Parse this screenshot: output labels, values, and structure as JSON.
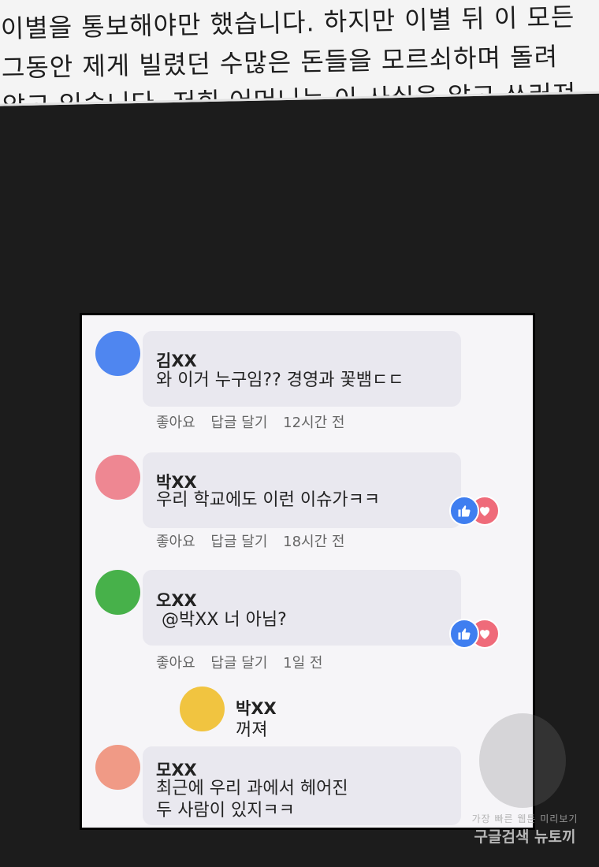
{
  "banner": {
    "line1": "이별을 통보해야만 했습니다. 하지만 이별 뒤 이 모든",
    "line2": "그동안 제게 빌렸던 수많은 돈들을 모르쇠하며 돌려",
    "line3": "않고 있습니다. 저희 어머니는 이 사실을 알고 쓰러져"
  },
  "colors": {
    "like": "#3f7ef0",
    "heart": "#ef6b7a",
    "avatar_blue": "#4f86f0",
    "avatar_pink": "#ee8792",
    "avatar_green": "#47b14a",
    "avatar_yellow": "#f1c440",
    "avatar_salmon": "#f09a86"
  },
  "comments": [
    {
      "name": "김XX",
      "text": "와 이거 누구임?? 경영과 꽃뱀ㄷㄷ",
      "like": "좋아요",
      "reply": "답글 달기",
      "time": "12시간 전"
    },
    {
      "name": "박XX",
      "text": "우리 학교에도 이런 이슈가ㅋㅋ",
      "like": "좋아요",
      "reply": "답글 달기",
      "time": "18시간 전",
      "reactions": [
        "like-icon",
        "heart-icon"
      ]
    },
    {
      "name": "오XX",
      "text": "@박XX 너 아님?",
      "like": "좋아요",
      "reply": "답글 달기",
      "time": "1일 전",
      "reactions": [
        "like-icon",
        "heart-icon"
      ]
    },
    {
      "name": "모XX",
      "text_line1": "최근에 우리 과에서 헤어진",
      "text_line2": "두 사람이 있지ㅋㅋ"
    }
  ],
  "reply": {
    "name": "박XX",
    "text": "꺼져"
  },
  "watermark": {
    "line1": "가장 빠른 웹툰 미리보기",
    "line2": "구글검색 뉴토끼"
  }
}
